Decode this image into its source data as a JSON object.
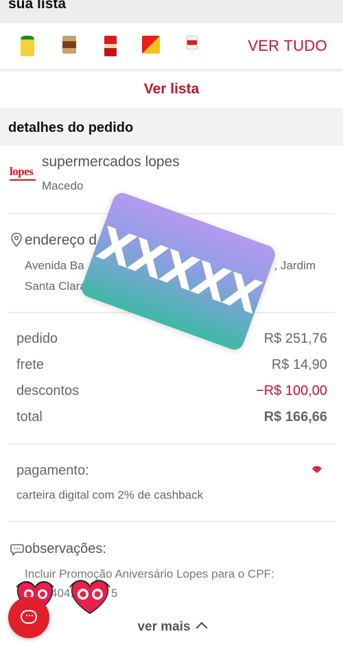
{
  "list": {
    "title": "sua lista",
    "thumbnails": [
      "oil-bottle-thumb",
      "coffee-jar-thumb",
      "sauce-bottle-thumb",
      "snack-bag-thumb",
      "cookie-pack-thumb"
    ],
    "ver_tudo": "VER TUDO",
    "ver_lista": "Ver lista"
  },
  "details": {
    "header": "detalhes do pedido",
    "store": {
      "logo_text": "lopes",
      "name": "supermercados lopes",
      "city": "Macedo"
    },
    "address": {
      "label": "endereço d",
      "line_left": "Avenida Ba",
      "line_right": ", Jardim",
      "line2": "Santa Clara, C"
    },
    "summary": [
      {
        "label": "pedido",
        "value": "R$ 251,76"
      },
      {
        "label": "frete",
        "value": "R$ 14,90"
      },
      {
        "label": "descontos",
        "value": "−R$ 100,00"
      },
      {
        "label": "total",
        "value": "R$ 166,66"
      }
    ],
    "payment": {
      "label": "pagamento:",
      "text": "carteira digital com 2% de cashback"
    },
    "notes": {
      "label": "observações:",
      "line1": "Incluir Promoção Aniversário Lopes para o CPF:",
      "line2": "404.",
      "line2_tail": "5"
    },
    "ver_mais": "ver mais"
  },
  "overlay": {
    "text": "XXXXX"
  },
  "colors": {
    "brand_red": "#c8102e",
    "chat_red": "#e0202b"
  }
}
